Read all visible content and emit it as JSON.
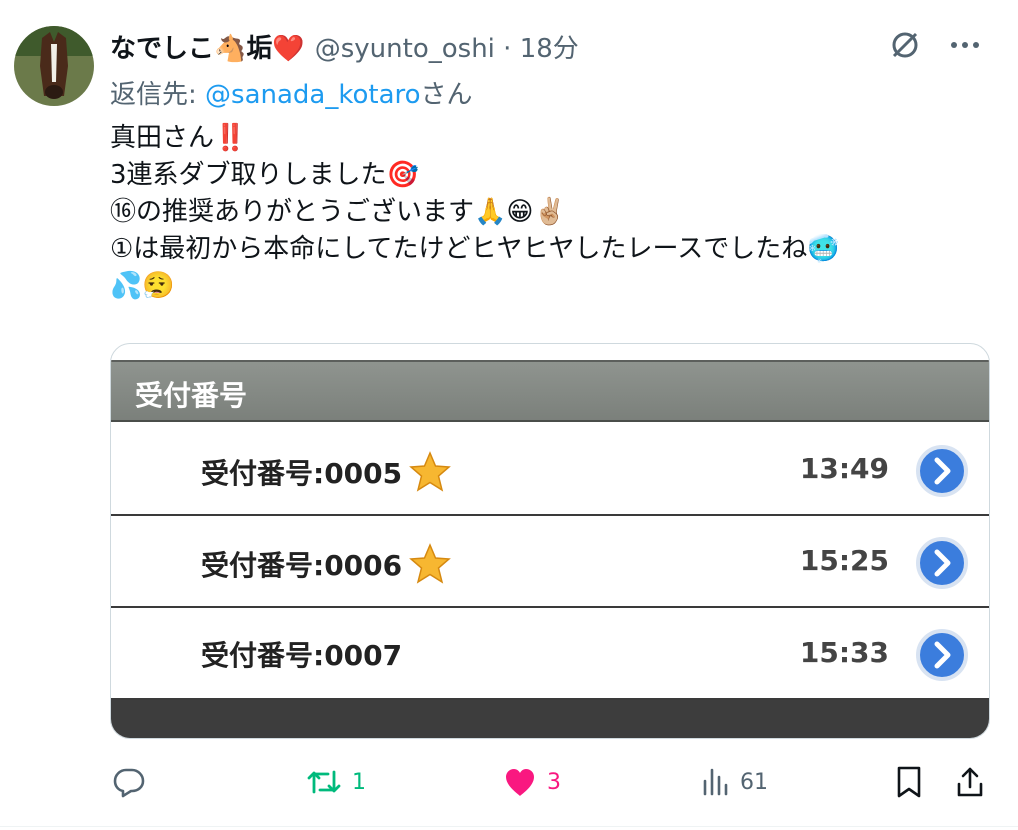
{
  "tweet": {
    "display_name": "なでしこ🐴垢❤️",
    "handle": "@syunto_oshi",
    "time_meta": " · 18分",
    "reply_prefix": "返信先: ",
    "reply_to": "@sanada_kotaro",
    "reply_suffix": "さん",
    "lines": [
      "真田さん‼️",
      "3連系ダブ取りしました🎯",
      "⑯の推奨ありがとうございます🙏😁✌🏼",
      "①は最初から本命にしてたけどヒヤヒヤしたレースでしたね🥶",
      "💦😮‍💨"
    ]
  },
  "receipt": {
    "header": "受付番号",
    "rows": [
      {
        "label": "受付番号:0005",
        "time": "13:49",
        "star": true
      },
      {
        "label": "受付番号:0006",
        "time": "15:25",
        "star": true
      },
      {
        "label": "受付番号:0007",
        "time": "15:33",
        "star": false
      }
    ]
  },
  "actions": {
    "retweet_count": "1",
    "like_count": "3",
    "views_count": "61"
  },
  "icons": {
    "top_right": [
      "grok-slash-icon",
      "more-icon"
    ],
    "action_bar": [
      "reply-icon",
      "retweet-icon",
      "heart-icon",
      "views-icon",
      "bookmark-icon",
      "share-icon"
    ]
  },
  "colors": {
    "accent": "#1d9bf0",
    "retweet": "#00ba7c",
    "like": "#f91880",
    "muted": "#536471"
  }
}
